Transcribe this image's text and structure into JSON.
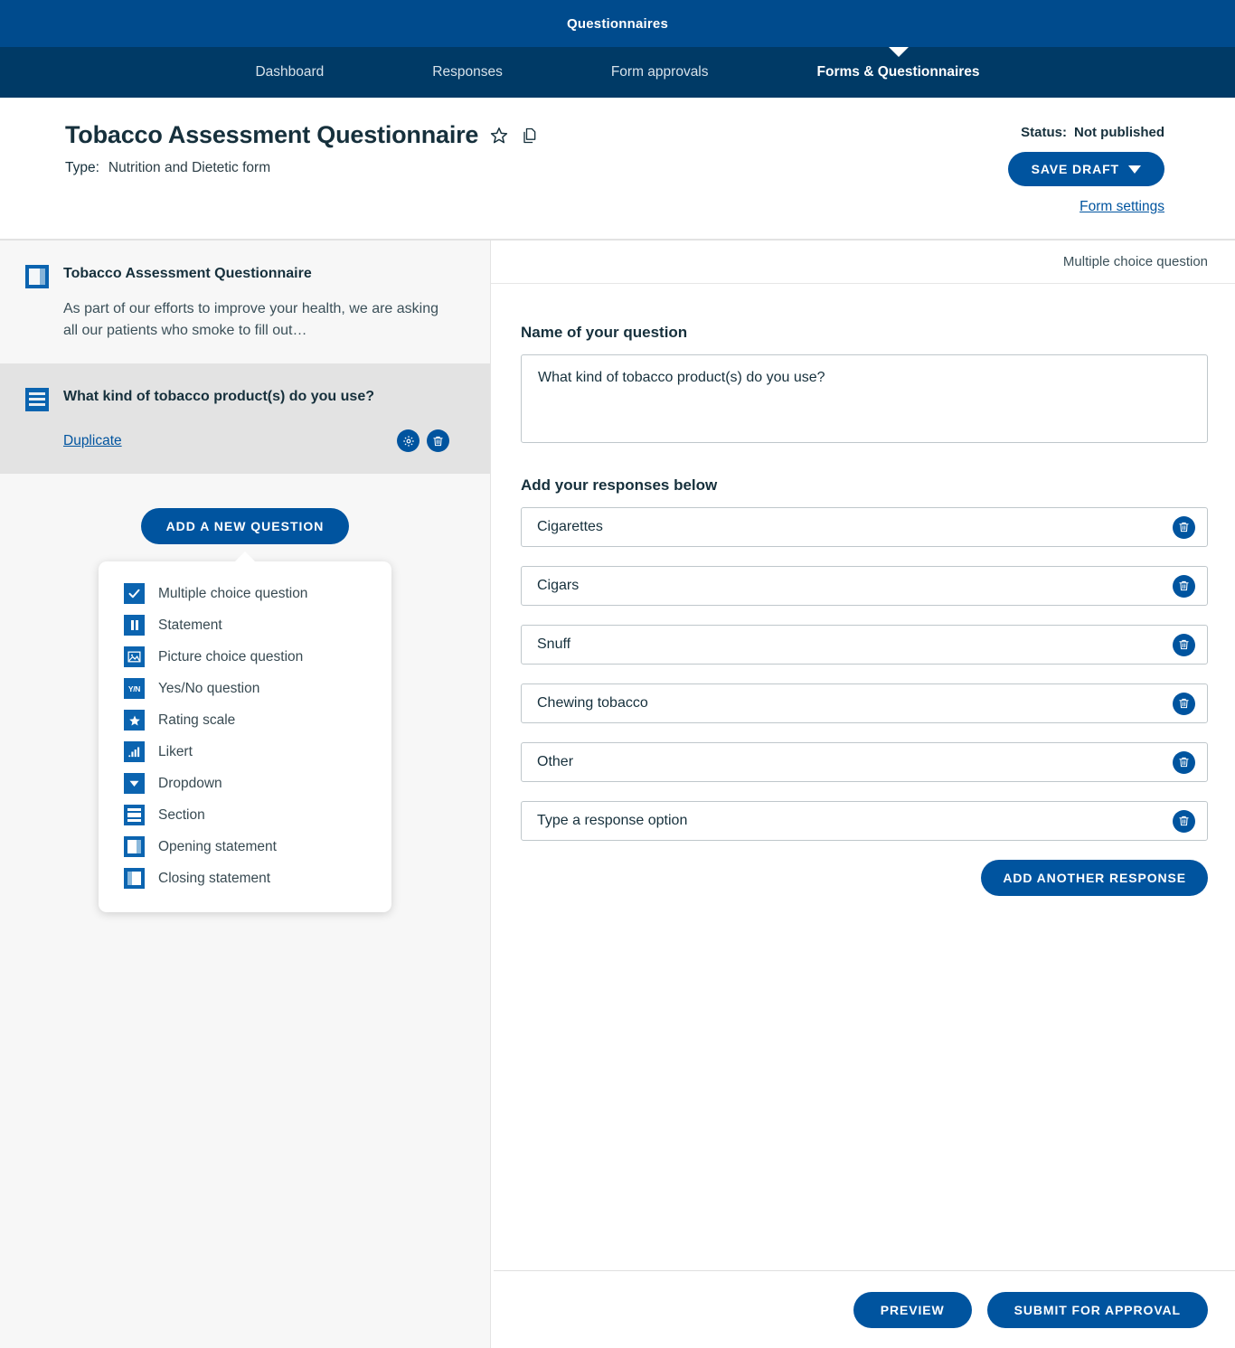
{
  "topbar": {
    "title": "Questionnaires"
  },
  "nav": {
    "items": [
      {
        "label": "Dashboard",
        "active": false
      },
      {
        "label": "Responses",
        "active": false
      },
      {
        "label": "Form approvals",
        "active": false
      },
      {
        "label": "Forms & Questionnaires",
        "active": true
      }
    ]
  },
  "header": {
    "title": "Tobacco Assessment Questionnaire",
    "favorite_icon": "star-outline-icon",
    "copy_icon": "copy-icon",
    "type_label": "Type:",
    "type_value": "Nutrition and Dietetic form",
    "status_label": "Status:",
    "status_value": "Not published",
    "save_draft_label": "SAVE DRAFT",
    "form_settings_label": "Form settings"
  },
  "sidebar": {
    "cards": [
      {
        "icon": "opening-statement-icon",
        "title": "Tobacco Assessment Questionnaire",
        "description": "As part of our efforts to improve your health, we are asking all our patients who smoke to fill out…",
        "selected": false
      },
      {
        "icon": "multiple-choice-icon",
        "title": "What kind of tobacco product(s) do you use?",
        "duplicate_label": "Duplicate",
        "settings_icon": "gear-icon",
        "delete_icon": "trash-icon",
        "selected": true
      }
    ],
    "add_question_label": "ADD A NEW QUESTION",
    "question_types": [
      {
        "label": "Multiple choice question",
        "icon": "checkmark-icon"
      },
      {
        "label": "Statement",
        "icon": "statement-icon"
      },
      {
        "label": "Picture choice question",
        "icon": "picture-icon"
      },
      {
        "label": "Yes/No question",
        "icon": "yes-no-icon"
      },
      {
        "label": "Rating scale",
        "icon": "star-icon"
      },
      {
        "label": "Likert",
        "icon": "bar-chart-icon"
      },
      {
        "label": "Dropdown",
        "icon": "chevron-down-icon"
      },
      {
        "label": "Section",
        "icon": "section-icon"
      },
      {
        "label": "Opening statement",
        "icon": "opening-statement-icon"
      },
      {
        "label": "Closing statement",
        "icon": "closing-statement-icon"
      }
    ]
  },
  "editor": {
    "type_label": "Multiple choice question",
    "question_name_label": "Name of your question",
    "question_name_value": "What kind of tobacco product(s) do you use?",
    "responses_label": "Add your responses below",
    "responses": [
      {
        "value": "Cigarettes",
        "placeholder": ""
      },
      {
        "value": "Cigars",
        "placeholder": ""
      },
      {
        "value": "Snuff",
        "placeholder": ""
      },
      {
        "value": "Chewing tobacco",
        "placeholder": ""
      },
      {
        "value": "Other",
        "placeholder": ""
      },
      {
        "value": "",
        "placeholder": "Type a response option"
      }
    ],
    "add_response_label": "ADD ANOTHER RESPONSE"
  },
  "action_bar": {
    "preview_label": "PREVIEW",
    "submit_label": "SUBMIT FOR APPROVAL"
  },
  "colors": {
    "topbar_blue": "#004b8d",
    "navbar_blue": "#003a66",
    "accent_blue": "#00549f",
    "icon_blue": "#0b64b0",
    "text_dark": "#16303c",
    "selected_row": "#e3e3e3",
    "sidebar_bg": "#f7f7f7"
  }
}
